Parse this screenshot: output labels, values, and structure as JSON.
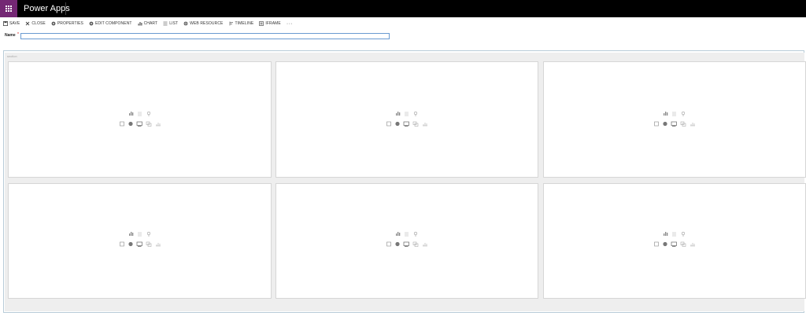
{
  "app": {
    "title": "Power Apps"
  },
  "toolbar": {
    "items": [
      {
        "label": "SAVE",
        "icon": "save-icon"
      },
      {
        "label": "CLOSE",
        "icon": "close-icon"
      },
      {
        "label": "PROPERTIES",
        "icon": "gear-icon"
      },
      {
        "label": "EDIT COMPONENT",
        "icon": "gear-icon"
      },
      {
        "label": "CHART",
        "icon": "chart-icon"
      },
      {
        "label": "LIST",
        "icon": "list-icon"
      },
      {
        "label": "WEB RESOURCE",
        "icon": "globe-icon"
      },
      {
        "label": "TIMELINE",
        "icon": "timeline-icon"
      },
      {
        "label": "IFRAME",
        "icon": "iframe-icon"
      }
    ],
    "more": "···"
  },
  "form": {
    "name_label": "Name",
    "required_marker": "*",
    "name_value": ""
  },
  "section": {
    "label": "section"
  },
  "colors": {
    "brand": "#742774",
    "topbar": "#000000",
    "input_border": "#6a9bd1",
    "section_border": "#b8ccd8"
  }
}
